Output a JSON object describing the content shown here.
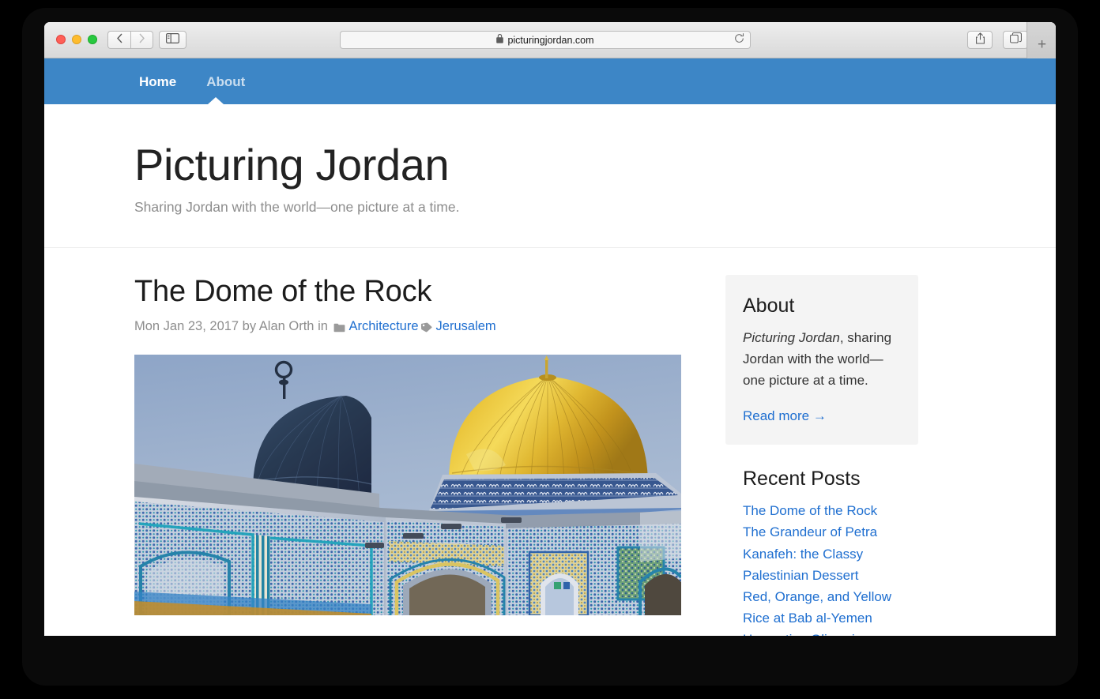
{
  "browser": {
    "url": "picturingjordan.com",
    "lock_icon": "lock-icon",
    "reload_icon": "reload-icon",
    "back_icon": "chevron-left-icon",
    "forward_icon": "chevron-right-icon",
    "sidebar_icon": "sidebar-toggle-icon",
    "share_icon": "share-icon",
    "tabs_icon": "show-all-tabs-icon",
    "new_tab_label": "+",
    "traffic_lights": {
      "close": "close-window-button",
      "minimize": "minimize-window-button",
      "maximize": "maximize-window-button"
    }
  },
  "site_nav": {
    "items": [
      {
        "label": "Home",
        "active": true
      },
      {
        "label": "About",
        "active": false
      }
    ]
  },
  "site_header": {
    "title": "Picturing Jordan",
    "tagline": "Sharing Jordan with the world—one picture at a time."
  },
  "post": {
    "title": "The Dome of the Rock",
    "meta_prefix": "Mon Jan 23, 2017 by Alan Orth in ",
    "category_icon": "folder-icon",
    "category": "Architecture",
    "tag_icon": "tag-icon",
    "tag": "Jerusalem",
    "photo_alt": "Dome of the Rock golden dome and tiled facade against blue sky"
  },
  "sidebar": {
    "about": {
      "title": "About",
      "body_emphasis": "Picturing Jordan",
      "body_rest": ", sharing Jordan with the world—one picture at a time.",
      "read_more": "Read more →"
    },
    "recent_posts": {
      "title": "Recent Posts",
      "items": [
        "The Dome of the Rock",
        "The Grandeur of Petra",
        "Kanafeh: the Classy Palestinian Dessert",
        "Red, Orange, and Yellow Rice at Bab al-Yemen",
        "Harvesting Olives in"
      ]
    }
  },
  "colors": {
    "nav_blue": "#3d86c6",
    "link_blue": "#1f6fd0",
    "widget_bg": "#f4f4f4",
    "muted_text": "#8d8d8d"
  }
}
